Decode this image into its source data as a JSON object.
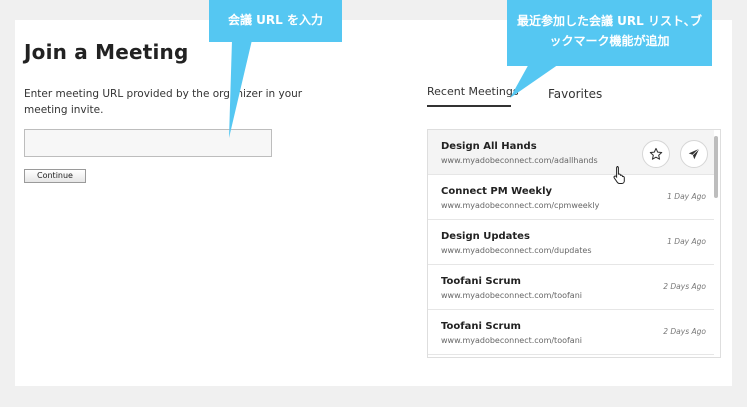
{
  "page": {
    "title": "Join a Meeting",
    "instructions": "Enter meeting URL provided by the organizer in your meeting invite.",
    "url_input": {
      "value": "",
      "placeholder": ""
    },
    "continue_label": "Continue"
  },
  "tabs": [
    {
      "label": "Recent Meetings",
      "active": true
    },
    {
      "label": "Favorites",
      "active": false
    }
  ],
  "meetings": [
    {
      "name": "Design All Hands",
      "url": "www.myadobeconnect.com/adallhands",
      "time": ""
    },
    {
      "name": "Connect PM Weekly",
      "url": "www.myadobeconnect.com/cpmweekly",
      "time": "1 Day Ago"
    },
    {
      "name": "Design Updates",
      "url": "www.myadobeconnect.com/dupdates",
      "time": "1 Day Ago"
    },
    {
      "name": "Toofani Scrum",
      "url": "www.myadobeconnect.com/toofani",
      "time": "2 Days Ago"
    },
    {
      "name": "Toofani Scrum",
      "url": "www.myadobeconnect.com/toofani",
      "time": "2 Days Ago"
    }
  ],
  "row_actions": {
    "favorite_icon": "star-icon",
    "join_icon": "paper-plane-icon"
  },
  "callouts": {
    "url_input": "会議 URL を入力",
    "recent_list": "最近参加した会議 URL リスト､ブックマーク機能が追加"
  },
  "colors": {
    "callout": "#55c7f2",
    "background": "#f0f0f0",
    "panel": "#ffffff"
  }
}
